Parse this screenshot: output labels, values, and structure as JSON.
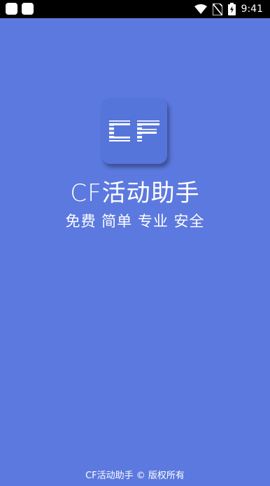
{
  "status_bar": {
    "time": "9:41",
    "icons": [
      "notification-icon",
      "notification-icon",
      "wifi-icon",
      "no-sim-icon",
      "battery-charging-icon"
    ]
  },
  "splash": {
    "app_name": "CF活动助手",
    "slogan": "免费 简单 专业 安全",
    "copyright": "CF活动助手 © 版权所有"
  },
  "colors": {
    "background": "#5c79df",
    "status_bar": "#000000",
    "text": "#ffffff"
  }
}
